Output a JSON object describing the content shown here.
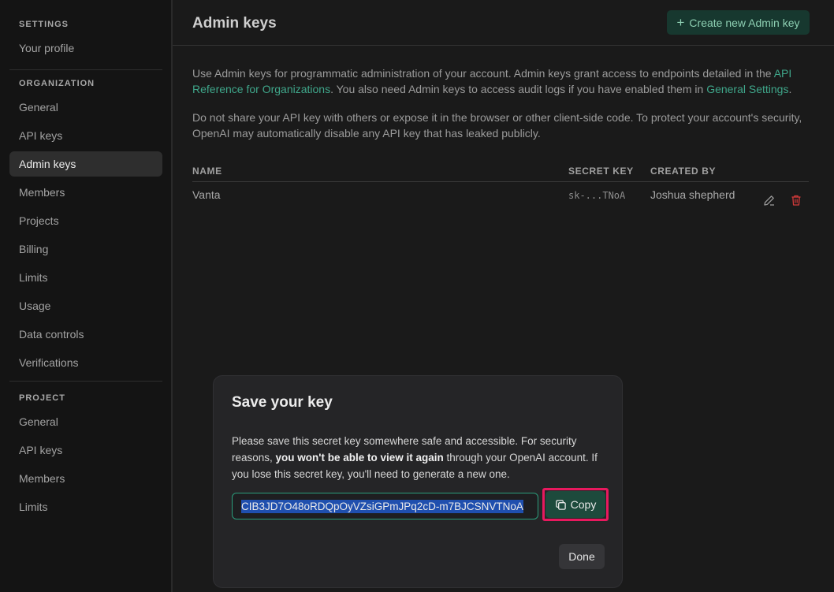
{
  "sidebar": {
    "settings_title": "SETTINGS",
    "settings_items": [
      {
        "label": "Your profile"
      }
    ],
    "organization_title": "ORGANIZATION",
    "organization_items": [
      {
        "label": "General"
      },
      {
        "label": "API keys"
      },
      {
        "label": "Admin keys"
      },
      {
        "label": "Members"
      },
      {
        "label": "Projects"
      },
      {
        "label": "Billing"
      },
      {
        "label": "Limits"
      },
      {
        "label": "Usage"
      },
      {
        "label": "Data controls"
      },
      {
        "label": "Verifications"
      }
    ],
    "project_title": "PROJECT",
    "project_items": [
      {
        "label": "General"
      },
      {
        "label": "API keys"
      },
      {
        "label": "Members"
      },
      {
        "label": "Limits"
      }
    ]
  },
  "header": {
    "title": "Admin keys",
    "create_button": "Create new Admin key"
  },
  "description": {
    "p1_before": "Use Admin keys for programmatic administration of your account. Admin keys grant access to endpoints detailed in the ",
    "p1_link": "API Reference for Organizations",
    "p1_middle": ". You also need Admin keys to access audit logs if you have enabled them in ",
    "p1_link2": "General Settings",
    "p1_after": ".",
    "p2": "Do not share your API key with others or expose it in the browser or other client-side code. To protect your account's security, OpenAI may automatically disable any API key that has leaked publicly."
  },
  "table": {
    "columns": [
      "NAME",
      "SECRET KEY",
      "CREATED BY"
    ],
    "rows": [
      {
        "name": "Vanta",
        "secret_key": "sk-...TNoA",
        "created_by": "Joshua shepherd"
      }
    ]
  },
  "modal": {
    "title": "Save your key",
    "text_before": "Please save this secret key somewhere safe and accessible. For security reasons, ",
    "text_bold": "you won't be able to view it again",
    "text_after": " through your OpenAI account. If you lose this secret key, you'll need to generate a new one.",
    "key_value": "CIB3JD7O48oRDQpOyVZsiGPmJPq2cD-m7BJCSNVTNoA",
    "copy_label": "Copy",
    "done_label": "Done"
  },
  "colors": {
    "accent": "#3fa68a",
    "highlight_box": "#e8195e",
    "delete_icon": "#d33a3a"
  }
}
